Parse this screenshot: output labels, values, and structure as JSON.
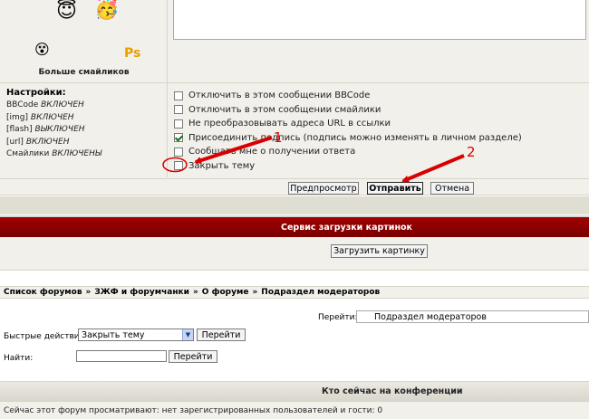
{
  "smilies": {
    "more_label": "Больше смайликов",
    "badge_text": "Ps"
  },
  "settings": {
    "title": "Настройки:",
    "items": [
      {
        "name": "BBCode",
        "state": "ВКЛЮЧЕН"
      },
      {
        "name": "[img]",
        "state": "ВКЛЮЧЕН"
      },
      {
        "name": "[flash]",
        "state": "ВЫКЛЮЧЕН"
      },
      {
        "name": "[url]",
        "state": "ВКЛЮЧЕН"
      },
      {
        "name": "Смайлики",
        "state": "ВКЛЮЧЕНЫ"
      }
    ]
  },
  "options": [
    {
      "label": "Отключить в этом сообщении BBCode",
      "checked": false
    },
    {
      "label": "Отключить в этом сообщении смайлики",
      "checked": false
    },
    {
      "label": "Не преобразовывать адреса URL в ссылки",
      "checked": false
    },
    {
      "label": "Присоединить подпись (подпись можно изменять в личном разделе)",
      "checked": true
    },
    {
      "label": "Сообщать мне о получении ответа",
      "checked": false
    },
    {
      "label": "Закрыть тему",
      "checked": false
    }
  ],
  "buttons": {
    "preview": "Предпросмотр",
    "submit": "Отправить",
    "cancel": "Отмена"
  },
  "upload": {
    "title": "Сервис загрузки картинок",
    "button": "Загрузить картинку"
  },
  "breadcrumb": {
    "items": [
      "Список форумов",
      "ЗЖФ и форумчанки",
      "О форуме",
      "Подраздел модераторов"
    ],
    "separator": "»"
  },
  "jump": {
    "label": "Перейти:",
    "selected": "Подраздел модераторов"
  },
  "quick_actions": {
    "label": "Быстрые действия:",
    "selected": "Закрыть тему",
    "go": "Перейти"
  },
  "find": {
    "label": "Найти:",
    "go": "Перейти"
  },
  "online": {
    "title": "Кто сейчас на конференции",
    "text": "Сейчас этот форум просматривают: нет зарегистрированных пользователей и гости: 0"
  },
  "annotations": {
    "label_1": "1",
    "label_2": "2",
    "color": "#d80000"
  }
}
